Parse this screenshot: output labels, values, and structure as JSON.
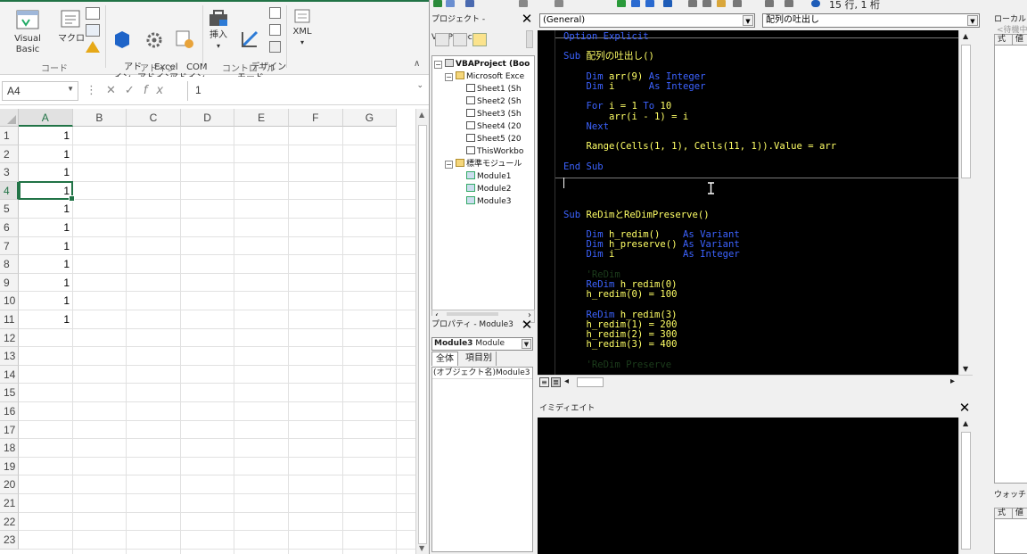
{
  "excel": {
    "ribbon": {
      "groups": [
        {
          "label": "コード",
          "buttons": [
            "Visual Basic",
            "マクロ"
          ]
        },
        {
          "label": "アドイン",
          "buttons": [
            "アド\nイン",
            "Excel\nアドイン",
            "COM\nアドイン"
          ]
        },
        {
          "label": "コントロール",
          "buttons": [
            "挿入",
            "デザイン\nモード"
          ]
        },
        {
          "label": "",
          "buttons": [
            "XML"
          ]
        }
      ],
      "collapse_icon": "chevron-up-icon"
    },
    "formula_bar": {
      "name_box": "A4",
      "fx": "fx",
      "formula": "1"
    },
    "sheet": {
      "columns": [
        "A",
        "B",
        "C",
        "D",
        "E",
        "F",
        "G"
      ],
      "selected_column": "A",
      "rows": [
        "1",
        "2",
        "3",
        "4",
        "5",
        "6",
        "7",
        "8",
        "9",
        "10",
        "11",
        "12",
        "13",
        "14",
        "15",
        "16",
        "17",
        "18",
        "19",
        "20",
        "21",
        "22",
        "23"
      ],
      "selected_row": "4",
      "column_a_values": [
        "1",
        "1",
        "1",
        "1",
        "1",
        "1",
        "1",
        "1",
        "1",
        "1",
        "1"
      ]
    }
  },
  "vbe": {
    "toolbar": {
      "position": "15 行, 1 桁"
    },
    "project_panel": {
      "title": "プロジェクト - VBAProject",
      "tree": [
        {
          "label": "VBAProject (Boo",
          "level": 0,
          "bold": true,
          "icon": "project-icon",
          "expander": "−"
        },
        {
          "label": "Microsoft Exce",
          "level": 1,
          "icon": "folder-icon",
          "expander": "−"
        },
        {
          "label": "Sheet1 (Sh",
          "level": 2,
          "icon": "sheet-icon"
        },
        {
          "label": "Sheet2 (Sh",
          "level": 2,
          "icon": "sheet-icon"
        },
        {
          "label": "Sheet3 (Sh",
          "level": 2,
          "icon": "sheet-icon"
        },
        {
          "label": "Sheet4 (20",
          "level": 2,
          "icon": "sheet-icon"
        },
        {
          "label": "Sheet5 (20",
          "level": 2,
          "icon": "sheet-icon"
        },
        {
          "label": "ThisWorkbo",
          "level": 2,
          "icon": "workbook-icon"
        },
        {
          "label": "標準モジュール",
          "level": 1,
          "icon": "folder-icon",
          "expander": "−"
        },
        {
          "label": "Module1",
          "level": 2,
          "icon": "module-icon"
        },
        {
          "label": "Module2",
          "level": 2,
          "icon": "module-icon"
        },
        {
          "label": "Module3",
          "level": 2,
          "icon": "module-icon"
        }
      ]
    },
    "properties_panel": {
      "title": "プロパティ - Module3",
      "object_name": "Module3",
      "object_type": "Module",
      "tabs": [
        "全体",
        "項目別"
      ],
      "rows": [
        "(オブジェクト名)Module3"
      ]
    },
    "code_window": {
      "object_combo": "(General)",
      "proc_combo": "配列の吐出し",
      "lines": [
        [
          [
            "kw",
            "Option Explicit"
          ]
        ],
        [],
        [
          [
            "kw",
            "Sub "
          ],
          [
            "tx",
            "配列の吐出し()"
          ]
        ],
        [],
        [
          [
            "kw",
            "    Dim "
          ],
          [
            "tx",
            "arr(9) "
          ],
          [
            "kw",
            "As Integer"
          ]
        ],
        [
          [
            "kw",
            "    Dim "
          ],
          [
            "tx",
            "i      "
          ],
          [
            "kw",
            "As Integer"
          ]
        ],
        [],
        [
          [
            "kw",
            "    For "
          ],
          [
            "tx",
            "i = 1 "
          ],
          [
            "kw",
            "To "
          ],
          [
            "tx",
            "10"
          ]
        ],
        [
          [
            "tx",
            "        arr(i - 1) = i"
          ]
        ],
        [
          [
            "kw",
            "    Next"
          ]
        ],
        [],
        [
          [
            "tx",
            "    Range(Cells(1, 1), Cells(11, 1)).Value = arr"
          ]
        ],
        [],
        [
          [
            "kw",
            "End Sub"
          ]
        ],
        [],
        [],
        [],
        [
          [
            "kw",
            "Sub "
          ],
          [
            "tx",
            "ReDimとReDimPreserve()"
          ]
        ],
        [],
        [
          [
            "kw",
            "    Dim "
          ],
          [
            "tx",
            "h_redim()    "
          ],
          [
            "kw",
            "As Variant"
          ]
        ],
        [
          [
            "kw",
            "    Dim "
          ],
          [
            "tx",
            "h_preserve() "
          ],
          [
            "kw",
            "As Variant"
          ]
        ],
        [
          [
            "kw",
            "    Dim "
          ],
          [
            "tx",
            "i            "
          ],
          [
            "kw",
            "As Integer"
          ]
        ],
        [],
        [
          [
            "cm",
            "    'ReDim"
          ]
        ],
        [
          [
            "kw",
            "    ReDim "
          ],
          [
            "tx",
            "h_redim(0)"
          ]
        ],
        [
          [
            "tx",
            "    h_redim(0) = 100"
          ]
        ],
        [],
        [
          [
            "kw",
            "    ReDim "
          ],
          [
            "tx",
            "h_redim(3)"
          ]
        ],
        [
          [
            "tx",
            "    h_redim(1) = 200"
          ]
        ],
        [
          [
            "tx",
            "    h_redim(2) = 300"
          ]
        ],
        [
          [
            "tx",
            "    h_redim(3) = 400"
          ]
        ],
        [],
        [
          [
            "cm",
            "    'ReDim Preserve"
          ]
        ]
      ]
    },
    "immediate": {
      "title": "イミディエイト"
    },
    "locals": {
      "title": "ローカル",
      "hint": "<待機中>",
      "headers": [
        "式",
        "値"
      ]
    },
    "watch": {
      "title": "ウォッチ",
      "headers": [
        "式",
        "値"
      ]
    },
    "colors": {
      "keyword": "#3c63ff",
      "text": "#ffff66",
      "comment": "#1c3d1c",
      "background": "#000000"
    }
  }
}
